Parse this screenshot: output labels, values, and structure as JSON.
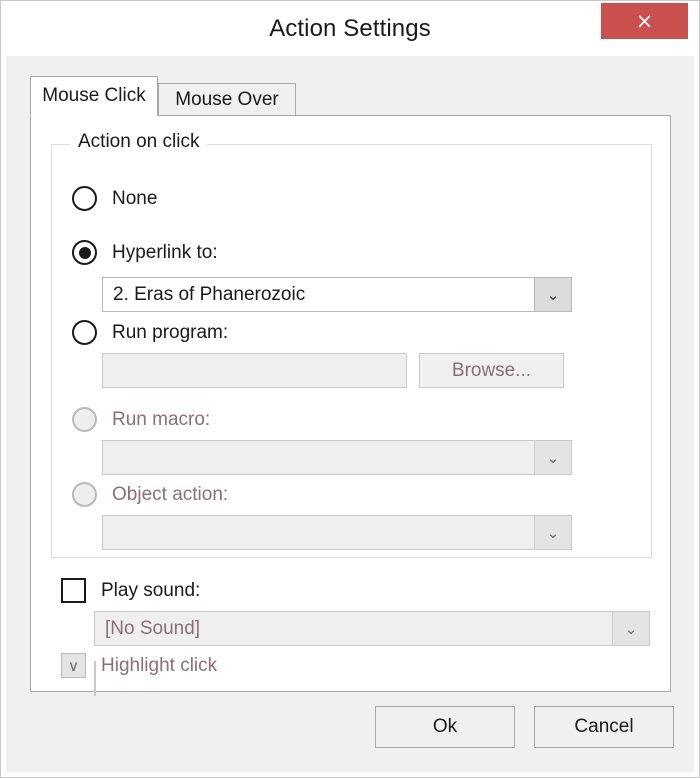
{
  "window": {
    "title": "Action Settings",
    "close_label": "×",
    "close_icon": "close-icon"
  },
  "tabs": [
    {
      "label": "Mouse Click",
      "active": true
    },
    {
      "label": "Mouse Over",
      "active": false
    }
  ],
  "group": {
    "legend": "Action on click",
    "options": [
      {
        "label": "None",
        "selected": false,
        "enabled": true
      },
      {
        "label": "Hyperlink to:",
        "selected": true,
        "enabled": true
      },
      {
        "label": "Run program:",
        "selected": false,
        "enabled": true
      },
      {
        "label": "Run macro:",
        "selected": false,
        "enabled": false
      },
      {
        "label": "Object action:",
        "selected": false,
        "enabled": false
      }
    ],
    "hyperlink_combo": {
      "value": "2. Eras of Phanerozoic",
      "arrow_icon": "chevron-down-icon",
      "enabled": true
    },
    "program_field": {
      "value": "",
      "placeholder": "",
      "enabled": false
    },
    "browse_button": {
      "label": "Browse...",
      "enabled": false
    },
    "macro_combo": {
      "value": "",
      "arrow_icon": "chevron-down-icon",
      "enabled": false
    },
    "object_action_combo": {
      "value": "",
      "arrow_icon": "chevron-down-icon",
      "enabled": false
    }
  },
  "play_sound": {
    "label": "Play sound:",
    "checked": false,
    "enabled": true,
    "combo": {
      "value": "[No Sound]",
      "arrow_icon": "chevron-down-icon",
      "enabled": false
    }
  },
  "highlight_click": {
    "label": "Highlight click",
    "glyph": "∨",
    "glyph_icon": "chevron-down-icon",
    "enabled": false
  },
  "footer": {
    "ok_label": "Ok",
    "cancel_label": "Cancel"
  },
  "colors": {
    "close_button": "#c9504f",
    "panel_bg": "#f0f0f0",
    "content_bg": "#ffffff",
    "disabled_text": "#8a6f78",
    "border": "#a8a8a8"
  }
}
